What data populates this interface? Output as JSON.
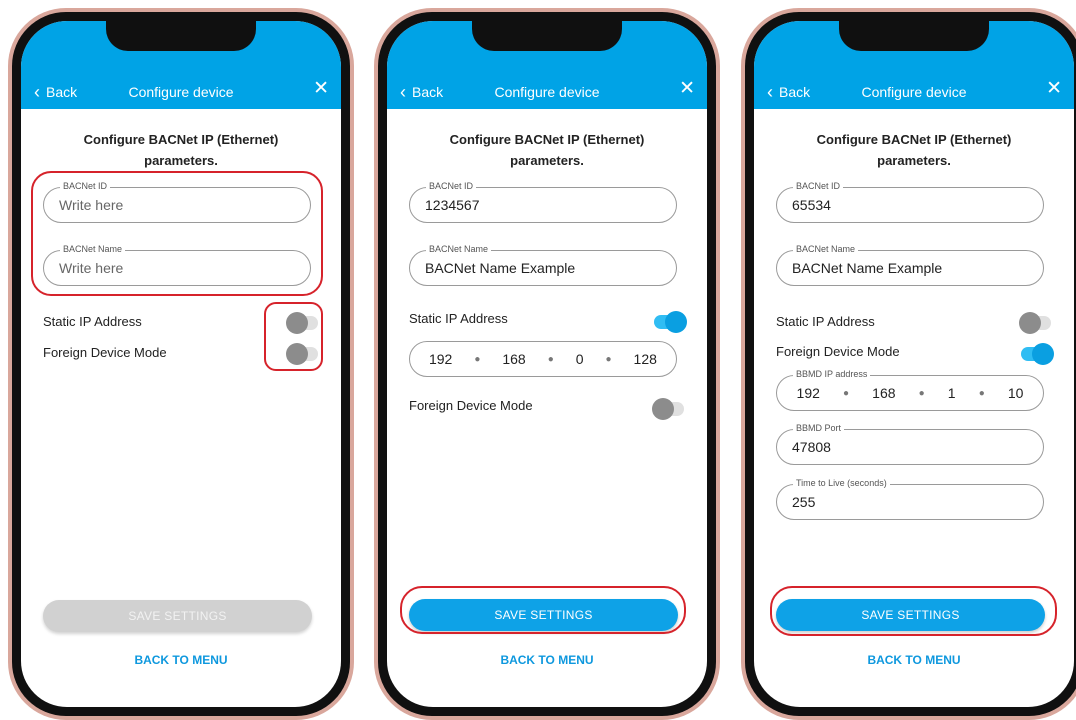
{
  "common": {
    "back_label": "Back",
    "title": "Configure device",
    "close_glyph": "✕",
    "back_glyph": "‹",
    "heading_line1": "Configure BACNet IP (Ethernet)",
    "heading_line2": "parameters.",
    "save_label": "SAVE SETTINGS",
    "back_to_menu": "BACK TO MENU"
  },
  "phone1": {
    "bacnet_id_label": "BACNet ID",
    "bacnet_id_placeholder": "Write here",
    "bacnet_name_label": "BACNet Name",
    "bacnet_name_placeholder": "Write here",
    "static_ip_label": "Static IP Address",
    "static_ip_on": false,
    "foreign_label": "Foreign Device Mode",
    "foreign_on": false,
    "save_enabled": false
  },
  "phone2": {
    "bacnet_id_label": "BACNet ID",
    "bacnet_id_value": "1234567",
    "bacnet_name_label": "BACNet Name",
    "bacnet_name_value": "BACNet Name Example",
    "static_ip_label": "Static IP Address",
    "static_ip_on": true,
    "ip": [
      "192",
      "168",
      "0",
      "128"
    ],
    "foreign_label": "Foreign Device Mode",
    "foreign_on": false,
    "save_enabled": true
  },
  "phone3": {
    "bacnet_id_label": "BACNet ID",
    "bacnet_id_value": "65534",
    "bacnet_name_label": "BACNet Name",
    "bacnet_name_value": "BACNet Name Example",
    "static_ip_label": "Static IP Address",
    "static_ip_on": false,
    "foreign_label": "Foreign Device Mode",
    "foreign_on": true,
    "bbmd_ip_label": "BBMD IP address",
    "bbmd_ip": [
      "192",
      "168",
      "1",
      "10"
    ],
    "bbmd_port_label": "BBMD Port",
    "bbmd_port_value": "47808",
    "ttl_label": "Time to Live (seconds)",
    "ttl_value": "255",
    "save_enabled": true
  },
  "colors": {
    "header": "#00a3e6",
    "highlight": "#d6232b",
    "toggle_on": "#0a9fe1",
    "toggle_off": "#8c8c8c",
    "link": "#0e98de"
  }
}
